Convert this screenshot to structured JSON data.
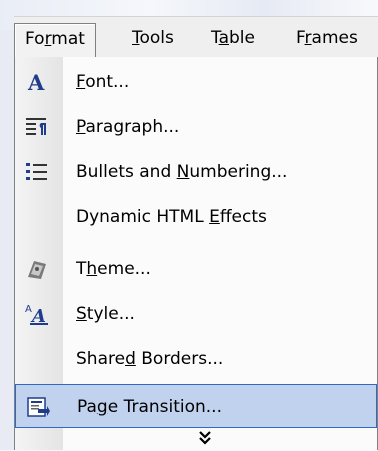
{
  "menubar": {
    "items": [
      {
        "pre": "Fo",
        "key": "r",
        "post": "mat"
      },
      {
        "pre": "",
        "key": "T",
        "post": "ools"
      },
      {
        "pre": "T",
        "key": "a",
        "post": "ble"
      },
      {
        "pre": "F",
        "key": "r",
        "post": "ames"
      }
    ]
  },
  "format_menu": {
    "items": [
      {
        "pre": "",
        "key": "F",
        "post": "ont...",
        "icon": "font-icon"
      },
      {
        "pre": "",
        "key": "P",
        "post": "aragraph...",
        "icon": "paragraph-icon"
      },
      {
        "pre": "Bullets and ",
        "key": "N",
        "post": "umbering...",
        "icon": "bullets-icon"
      },
      {
        "pre": "Dynamic HTML ",
        "key": "E",
        "post": "ffects",
        "icon": ""
      },
      {
        "pre": "T",
        "key": "h",
        "post": "eme...",
        "icon": "theme-icon"
      },
      {
        "pre": "",
        "key": "S",
        "post": "tyle...",
        "icon": "style-icon"
      },
      {
        "pre": "Share",
        "key": "d",
        "post": " Borders...",
        "icon": ""
      },
      {
        "pre": "Pa",
        "key": "g",
        "post": "e Transition...",
        "icon": "page-transition-icon"
      }
    ],
    "highlighted_item": "Page Transition...",
    "expand_icon": "double-chevron-down-icon",
    "highlight_color": "#c1d2ee",
    "highlight_border": "#316ac5"
  }
}
